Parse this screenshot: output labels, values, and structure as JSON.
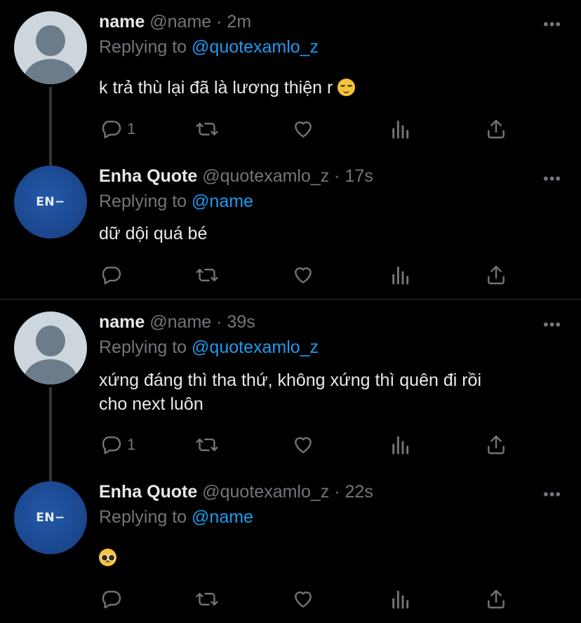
{
  "tweets": [
    {
      "name": "name",
      "handle": "@name",
      "time": "2m",
      "replying_label": "Replying to",
      "replying_to": "@quotexamlo_z",
      "text": "k trả thù lại đã là lương thiện r",
      "emoji": "relieved-face",
      "reply_count": "1"
    },
    {
      "name": "Enha Quote",
      "handle": "@quotexamlo_z",
      "time": "17s",
      "replying_label": "Replying to",
      "replying_to": "@name",
      "text": "dữ dội quá bé",
      "avatar_logo": "EN−",
      "reply_count": ""
    },
    {
      "name": "name",
      "handle": "@name",
      "time": "39s",
      "replying_label": "Replying to",
      "replying_to": "@quotexamlo_z",
      "text_line1": "xứng đáng thì tha thứ, không xứng thì quên đi rồi",
      "text_line2": "cho next luôn",
      "reply_count": "1"
    },
    {
      "name": "Enha Quote",
      "handle": "@quotexamlo_z",
      "time": "22s",
      "replying_label": "Replying to",
      "replying_to": "@name",
      "emoji": "pleading-face",
      "avatar_logo": "EN−",
      "reply_count": ""
    }
  ],
  "separator": "·",
  "more_label": "•••",
  "colors": {
    "background": "#000000",
    "text": "#e7e9ea",
    "muted": "#71767b",
    "accent": "#1d9bf0",
    "divider": "#2f3336"
  }
}
